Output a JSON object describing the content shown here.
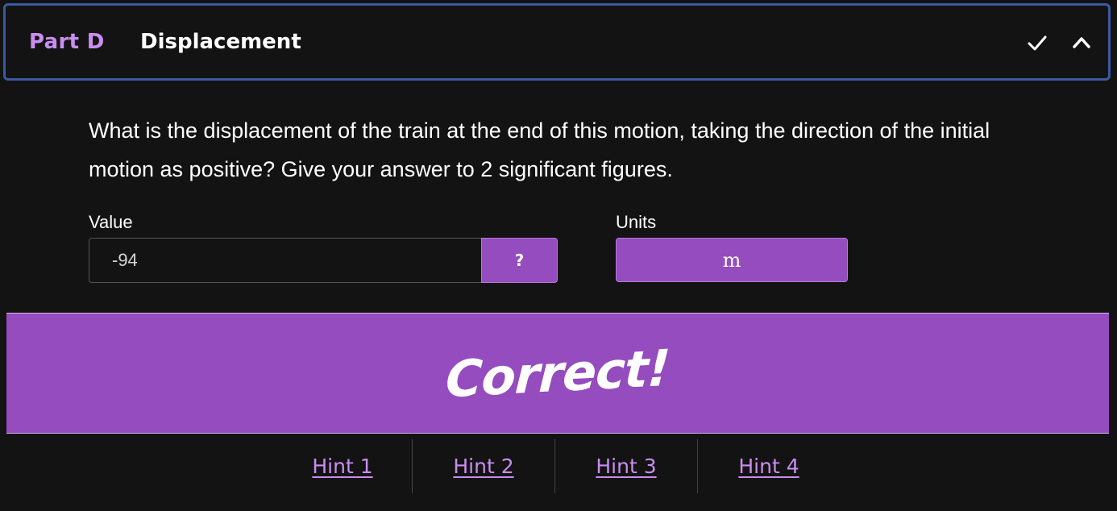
{
  "part": {
    "label": "Part D",
    "title": "Displacement"
  },
  "header_icons": [
    "check-icon",
    "chevron-up-icon"
  ],
  "question": {
    "text": "What is the displacement of the train at the end of this motion, taking the direction of the initial motion as positive? Give your answer to 2 significant figures."
  },
  "answer": {
    "value_label": "Value",
    "value": "-94",
    "help_label": "?",
    "units_label": "Units",
    "units_value": "m"
  },
  "feedback": {
    "text": "Correct!"
  },
  "hints": [
    {
      "label": "Hint 1"
    },
    {
      "label": "Hint 2"
    },
    {
      "label": "Hint 3"
    },
    {
      "label": "Hint 4"
    }
  ],
  "colors": {
    "accent": "#954cbf",
    "accent_text": "#c98ef0",
    "header_border": "#3b5aa0",
    "background": "#131313"
  }
}
